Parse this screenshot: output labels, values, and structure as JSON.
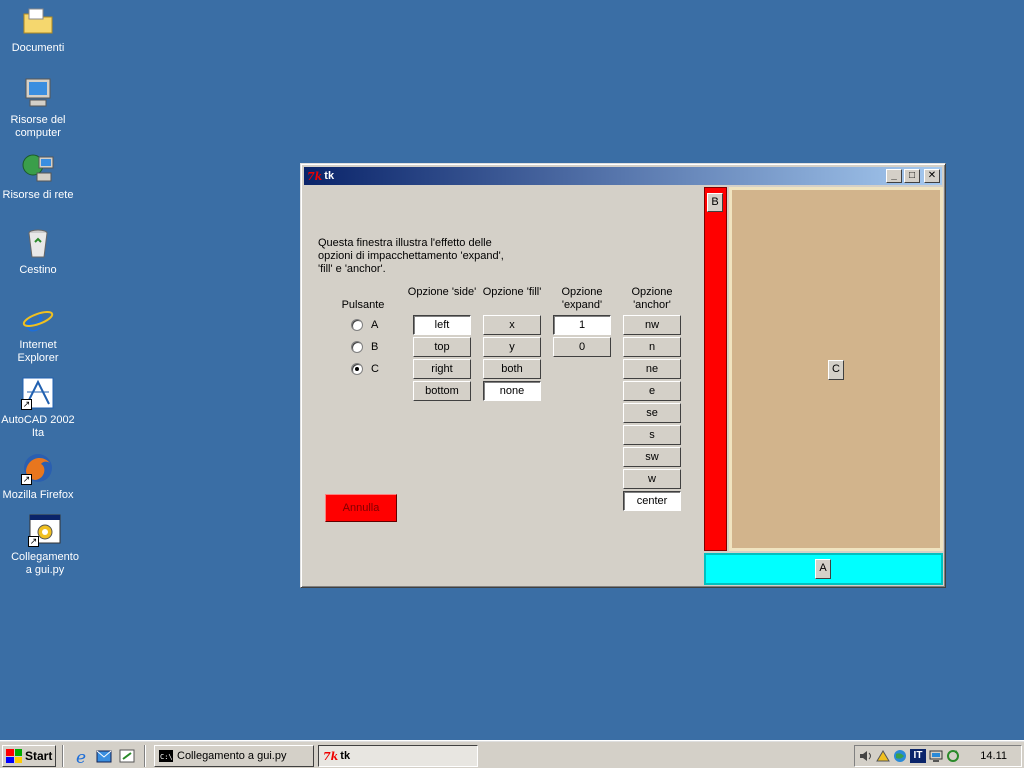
{
  "desktop": {
    "icons": [
      {
        "label": "Documenti"
      },
      {
        "label": "Risorse del computer"
      },
      {
        "label": "Risorse di rete"
      },
      {
        "label": "Cestino"
      },
      {
        "label": "Internet Explorer"
      },
      {
        "label": "AutoCAD 2002 Ita"
      },
      {
        "label": "Mozilla Firefox"
      },
      {
        "label": "Collegamento a gui.py"
      }
    ]
  },
  "window": {
    "logo": "7k",
    "title": "tk",
    "minimize": "_",
    "maximize": "□",
    "close": "✕",
    "description": "Questa finestra illustra l'effetto delle opzioni di impacchettamento 'expand', 'fill' e 'anchor'.",
    "button_label": "Pulsante",
    "radios": [
      {
        "label": "A",
        "checked": false
      },
      {
        "label": "B",
        "checked": false
      },
      {
        "label": "C",
        "checked": true
      }
    ],
    "columns": {
      "side": {
        "header": "Opzione 'side'",
        "options": [
          "left",
          "top",
          "right",
          "bottom"
        ],
        "selected": "left"
      },
      "fill": {
        "header": "Opzione 'fill'",
        "options": [
          "x",
          "y",
          "both",
          "none"
        ],
        "selected": "none"
      },
      "expand": {
        "header": "Opzione 'expand'",
        "options": [
          "1",
          "0"
        ],
        "selected": "1"
      },
      "anchor": {
        "header": "Opzione 'anchor'",
        "options": [
          "nw",
          "n",
          "ne",
          "e",
          "se",
          "s",
          "sw",
          "w",
          "center"
        ],
        "selected": "center"
      }
    },
    "cancel_label": "Annulla",
    "demo": {
      "button_b": "B",
      "button_c": "C",
      "button_a": "A"
    }
  },
  "taskbar": {
    "start_label": "Start",
    "tasks": [
      {
        "label": "Collegamento a gui.py",
        "active": false
      },
      {
        "label": "tk",
        "active": true
      }
    ],
    "tray_lang": "IT",
    "clock": "14.11"
  },
  "colors": {
    "desktop": "#3a6ea5",
    "red_frame": "#ff0000",
    "tan_frame": "#d2b48c",
    "cyan_frame": "#00ffff"
  }
}
